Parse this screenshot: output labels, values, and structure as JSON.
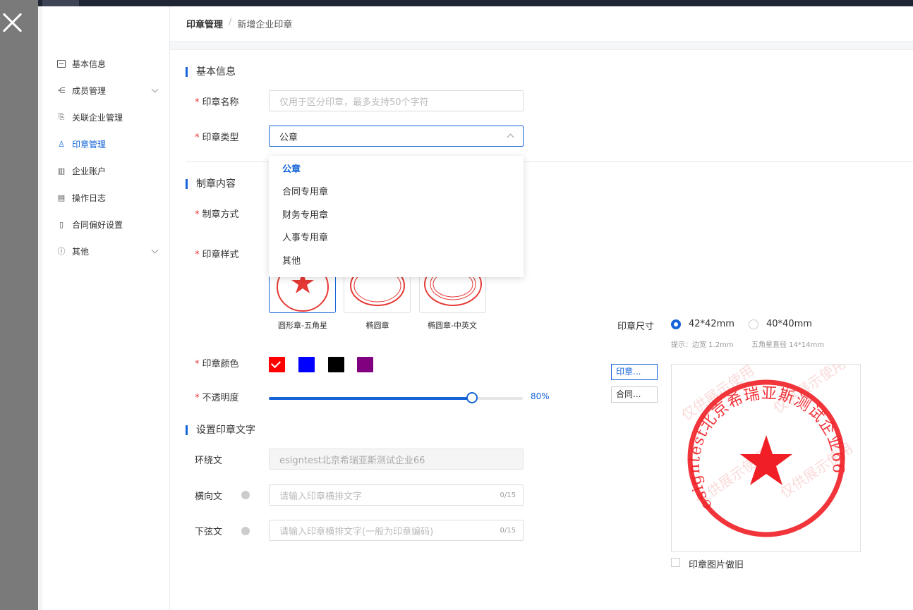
{
  "breadcrumb": {
    "parent": "印章管理",
    "separator": "/",
    "current": "新增企业印章"
  },
  "sidebar": {
    "items": [
      {
        "label": "基本信息",
        "icon": "list-icon"
      },
      {
        "label": "成员管理",
        "icon": "org-icon",
        "expandable": true
      },
      {
        "label": "关联企业管理",
        "icon": "link-doc-icon"
      },
      {
        "label": "印章管理",
        "icon": "stamp-icon",
        "active": true
      },
      {
        "label": "企业账户",
        "icon": "building-icon"
      },
      {
        "label": "操作日志",
        "icon": "log-icon"
      },
      {
        "label": "合同偏好设置",
        "icon": "contract-icon"
      },
      {
        "label": "其他",
        "icon": "info-icon",
        "expandable": true
      }
    ]
  },
  "basic": {
    "title": "基本信息",
    "name_label": "印章名称",
    "name_placeholder": "仅用于区分印章，最多支持50个字符",
    "type_label": "印章类型",
    "type_value": "公章"
  },
  "dropdown": {
    "options": [
      "公章",
      "合同专用章",
      "财务专用章",
      "人事专用章",
      "其他"
    ],
    "selected": "公章"
  },
  "content": {
    "title": "制章内容",
    "method_label": "制章方式",
    "style_label": "印章样式",
    "styles": [
      "圆形章-五角星",
      "椭圆章",
      "椭圆章-中英文"
    ],
    "color_label": "印章颜色",
    "colors": [
      "#ff0000",
      "#0000ff",
      "#000000",
      "#800080"
    ],
    "opacity_label": "不透明度",
    "opacity_value": "80%",
    "opacity_fraction": 0.8
  },
  "size": {
    "label": "印章尺寸",
    "options": [
      "42*42mm",
      "40*40mm"
    ],
    "selected": "42*42mm",
    "hint_border": "提示：边宽 1.2mm",
    "hint_star": "五角星直径 14*14mm"
  },
  "side_buttons": [
    "印章...",
    "合同..."
  ],
  "text": {
    "title": "设置印章文字",
    "ring_label": "环绕文",
    "ring_value": "esigntest北京希瑞亚斯测试企业66",
    "horizontal_label": "横向文",
    "horizontal_placeholder": "请输入印章横排文字",
    "horizontal_count": "0/15",
    "bottom_label": "下弦文",
    "bottom_placeholder": "请输入印章横排文字(一般为印章编码)",
    "bottom_count": "0/15"
  },
  "preview": {
    "ring_text": "esigntest北京希瑞亚斯测试企业66",
    "watermark": "仅供展示使用",
    "aged_label": "印章图片做旧"
  }
}
